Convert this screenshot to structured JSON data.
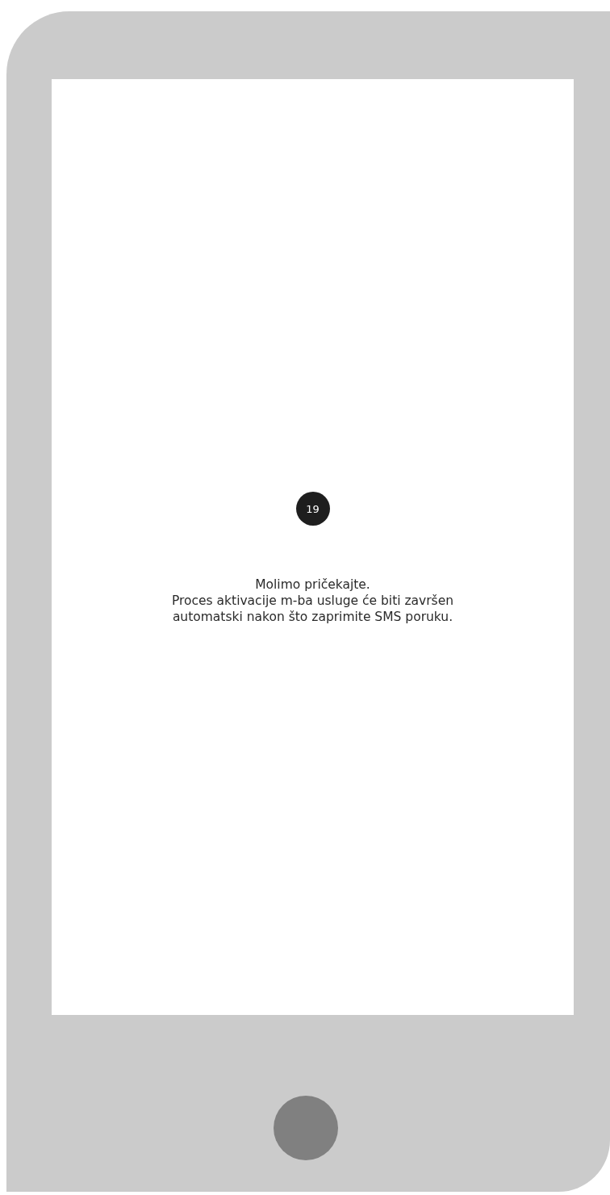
{
  "countdown": "19",
  "message": {
    "title": "Molimo pričekajte.",
    "lines": [
      "Proces aktivacije m-ba usluge će biti završen",
      "automatski nakon što zaprimite SMS poruku."
    ]
  }
}
